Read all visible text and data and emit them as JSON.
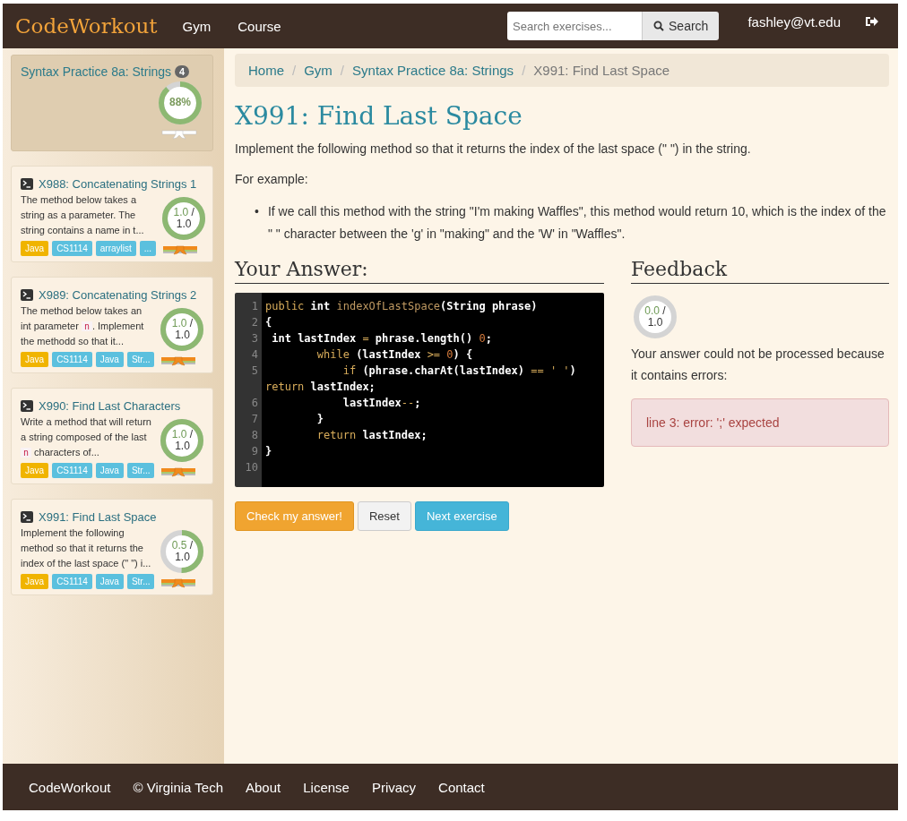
{
  "navbar": {
    "logo": "CodeWorkout",
    "links": [
      "Gym",
      "Course"
    ],
    "search": {
      "placeholder": "Search exercises...",
      "button": "Search"
    },
    "user": "fashley@vt.edu"
  },
  "sidebar": {
    "title": "Syntax Practice 8a: Strings",
    "badge": "4",
    "progress": {
      "label": "88%",
      "level": 0.88
    },
    "belt": {
      "color": "#ffffff"
    },
    "exercises": [
      {
        "title": "X988: Concatenating Strings 1",
        "description": [
          {
            "kind": "text",
            "text": "The method below takes a string as a parameter. The string contains a name in t..."
          }
        ],
        "score": "1.0",
        "slash": "/",
        "max": "1.0",
        "level": 1.0,
        "belt": {
          "color": "#f08a1c"
        },
        "tags": [
          {
            "label": "Java",
            "color": "#f0b400"
          },
          {
            "label": "CS1114",
            "color": "#5bc0de"
          },
          {
            "label": "arraylist",
            "color": "#5bc0de"
          },
          {
            "label": "...",
            "color": "#5bc0de"
          }
        ]
      },
      {
        "title": "X989: Concatenating Strings 2",
        "description": [
          {
            "kind": "text",
            "text": "The method below takes an int parameter "
          },
          {
            "kind": "code",
            "text": "n"
          },
          {
            "kind": "text",
            "text": ". Implement the methodd so that it..."
          }
        ],
        "score": "1.0",
        "slash": "/",
        "max": "1.0",
        "level": 1.0,
        "belt": {
          "color": "#f08a1c"
        },
        "tags": [
          {
            "label": "Java",
            "color": "#f0b400"
          },
          {
            "label": "CS1114",
            "color": "#5bc0de"
          },
          {
            "label": "Java",
            "color": "#5bc0de"
          },
          {
            "label": "Str...",
            "color": "#5bc0de"
          }
        ]
      },
      {
        "title": "X990: Find Last Characters",
        "description": [
          {
            "kind": "text",
            "text": "Write a method that will return a string composed of the last "
          },
          {
            "kind": "code",
            "text": "n"
          },
          {
            "kind": "text",
            "text": " characters of..."
          }
        ],
        "score": "1.0",
        "slash": "/",
        "max": "1.0",
        "level": 1.0,
        "belt": {
          "color": "#f08a1c"
        },
        "tags": [
          {
            "label": "Java",
            "color": "#f0b400"
          },
          {
            "label": "CS1114",
            "color": "#5bc0de"
          },
          {
            "label": "Java",
            "color": "#5bc0de"
          },
          {
            "label": "Str...",
            "color": "#5bc0de"
          }
        ]
      },
      {
        "title": "X991: Find Last Space",
        "description": [
          {
            "kind": "text",
            "text": "Implement the following method so that it returns the index of the last space (\" \") i..."
          }
        ],
        "score": "0.5",
        "slash": "/",
        "max": "1.0",
        "level": 0.5,
        "belt": {
          "color": "#f08a1c"
        },
        "tags": [
          {
            "label": "Java",
            "color": "#f0b400"
          },
          {
            "label": "CS1114",
            "color": "#5bc0de"
          },
          {
            "label": "Java",
            "color": "#5bc0de"
          },
          {
            "label": "Str...",
            "color": "#5bc0de"
          }
        ]
      }
    ]
  },
  "breadcrumb": {
    "separator": "/",
    "links": [
      "Home",
      "Gym",
      "Syntax Practice 8a: Strings"
    ],
    "current": "X991: Find Last Space"
  },
  "exercise": {
    "title": "X991: Find Last Space",
    "prompt": "Implement the following method so that it returns the index of the last space (\" \") in the string.",
    "example_label": "For example:",
    "bullet_marker": "•",
    "bullets": [
      "If we call this method with the string \"I'm making Waffles\", this method would return 10, which is the index of the \" \" character between the 'g' in \"making\" and the 'W' in \"Waffles\"."
    ]
  },
  "answer": {
    "heading": "Your Answer:",
    "lines": [
      {
        "number": "1",
        "tokens": [
          {
            "text": "public",
            "kind": "kw"
          },
          {
            "text": " int ",
            "kind": "type"
          },
          {
            "text": "indexOfLastSpace",
            "kind": "fn"
          },
          {
            "text": "(String phrase)",
            "kind": "plain"
          }
        ]
      },
      {
        "number": "2",
        "tokens": [
          {
            "text": "{",
            "kind": "plain"
          }
        ]
      },
      {
        "number": "3",
        "tokens": [
          {
            "text": " int",
            "kind": "type"
          },
          {
            "text": " lastIndex ",
            "kind": "plain"
          },
          {
            "text": "=",
            "kind": "op"
          },
          {
            "text": " phrase.length() ",
            "kind": "plain"
          },
          {
            "text": "0",
            "kind": "num"
          },
          {
            "text": ";",
            "kind": "plain"
          }
        ]
      },
      {
        "number": "4",
        "tokens": [
          {
            "text": "        while",
            "kind": "kw"
          },
          {
            "text": " (lastIndex ",
            "kind": "plain"
          },
          {
            "text": ">=",
            "kind": "op"
          },
          {
            "text": " 0",
            "kind": "num"
          },
          {
            "text": ") {",
            "kind": "plain"
          }
        ]
      },
      {
        "number": "5",
        "tokens": [
          {
            "text": "            if",
            "kind": "kw"
          },
          {
            "text": " (phrase.charAt(lastIndex) ",
            "kind": "plain"
          },
          {
            "text": "==",
            "kind": "op"
          },
          {
            "text": " ' '",
            "kind": "op"
          },
          {
            "text": ") ",
            "kind": "plain"
          },
          {
            "text": "return",
            "kind": "kw"
          },
          {
            "text": " lastIndex;",
            "kind": "plain"
          }
        ]
      },
      {
        "number": "6",
        "tokens": [
          {
            "text": "            lastIndex",
            "kind": "plain"
          },
          {
            "text": "--",
            "kind": "op"
          },
          {
            "text": ";",
            "kind": "plain"
          }
        ]
      },
      {
        "number": "7",
        "tokens": [
          {
            "text": "        }",
            "kind": "plain"
          }
        ]
      },
      {
        "number": "8",
        "tokens": [
          {
            "text": "        return",
            "kind": "kw"
          },
          {
            "text": " lastIndex;",
            "kind": "plain"
          }
        ]
      },
      {
        "number": "9",
        "tokens": [
          {
            "text": "}",
            "kind": "plain"
          }
        ]
      },
      {
        "number": "10"
      }
    ],
    "buttons": [
      {
        "label": "Check my answer!",
        "kind": "warning"
      },
      {
        "label": "Reset",
        "kind": "default"
      },
      {
        "label": "Next exercise",
        "kind": "info"
      }
    ]
  },
  "feedback": {
    "heading": "Feedback",
    "score": "0.0",
    "slash": "/",
    "max": "1.0",
    "level": 0.0,
    "message": "Your answer could not be processed because it contains errors:",
    "error": "line 3: error: ';' expected"
  },
  "footer": {
    "brand": "CodeWorkout",
    "copyright": "© Virginia Tech",
    "links": [
      "About",
      "License",
      "Privacy",
      "Contact"
    ]
  }
}
